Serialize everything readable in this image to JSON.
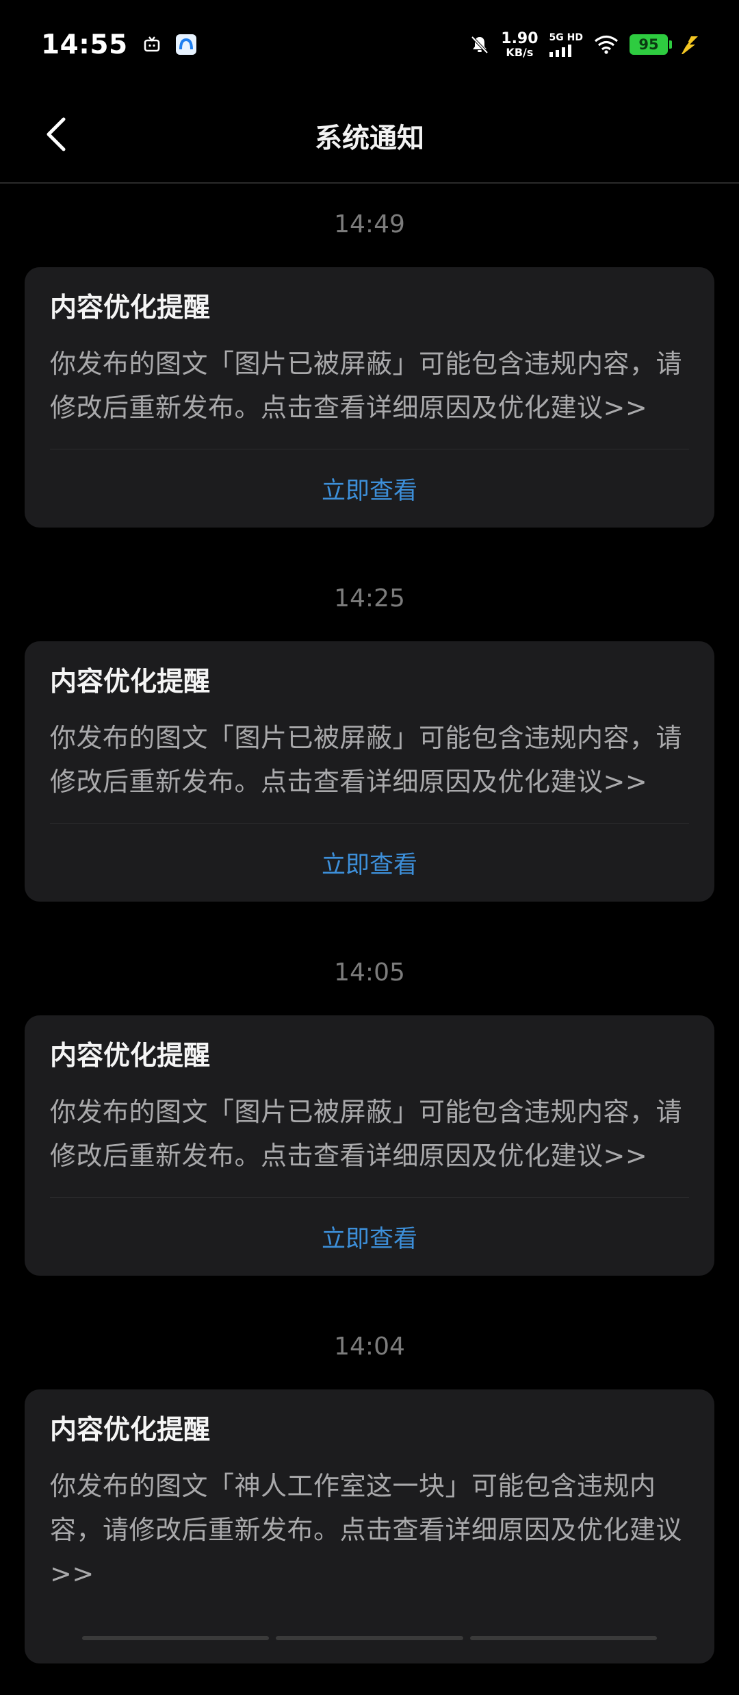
{
  "status_bar": {
    "time": "14:55",
    "net_speed_value": "1.90",
    "net_speed_unit": "KB/s",
    "signal_label": "5G HD",
    "battery_level": "95",
    "icons": [
      "tv-icon",
      "app-icon",
      "mute-icon",
      "signal-icon",
      "wifi-icon",
      "battery-icon",
      "charging-icon"
    ],
    "battery_color": "#2ecc40"
  },
  "header": {
    "title": "系统通知",
    "back_icon": "chevron-left-icon"
  },
  "notifications": [
    {
      "time": "14:49",
      "title": "内容优化提醒",
      "body": "你发布的图文「图片已被屏蔽」可能包含违规内容，请修改后重新发布。点击查看详细原因及优化建议>>",
      "action": "立即查看"
    },
    {
      "time": "14:25",
      "title": "内容优化提醒",
      "body": "你发布的图文「图片已被屏蔽」可能包含违规内容，请修改后重新发布。点击查看详细原因及优化建议>>",
      "action": "立即查看"
    },
    {
      "time": "14:05",
      "title": "内容优化提醒",
      "body": "你发布的图文「图片已被屏蔽」可能包含违规内容，请修改后重新发布。点击查看详细原因及优化建议>>",
      "action": "立即查看"
    },
    {
      "time": "14:04",
      "title": "内容优化提醒",
      "body": "你发布的图文「神人工作室这一块」可能包含违规内容，请修改后重新发布。点击查看详细原因及优化建议>>"
    }
  ],
  "colors": {
    "background": "#000000",
    "card": "#1c1c1e",
    "action_link": "#3d8fd9",
    "timestamp": "#7c7c7c"
  }
}
